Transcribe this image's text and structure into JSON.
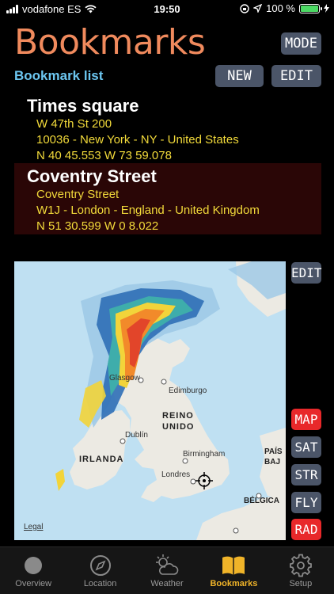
{
  "status_bar": {
    "carrier": "vodafone ES",
    "time": "19:50",
    "battery": "100 %",
    "battery_level": 1.0
  },
  "header": {
    "title": "Bookmarks",
    "mode_label": "MODE"
  },
  "list": {
    "label": "Bookmark list",
    "new_label": "NEW",
    "edit_label": "EDIT"
  },
  "bookmarks": [
    {
      "name": "Times square",
      "street": "W 47th St 200",
      "locality": "10036 - New York - NY - United States",
      "coords": "N 40 45.553   W 73 59.078"
    },
    {
      "name": "Coventry Street",
      "street": "Coventry Street",
      "locality": "W1J - London - England - United Kingdom",
      "coords": "N 51 30.599   W 0 8.022"
    }
  ],
  "map": {
    "edit_label": "EDIT",
    "labels": {
      "glasgow": "Glasgow",
      "edimburgo": "Edimburgo",
      "reino": "REINO",
      "unido": "UNIDO",
      "dublin": "Dublín",
      "irlanda": "IRLANDA",
      "birmingham": "Birmingham",
      "londres": "Londres",
      "pais": "PAÍS",
      "baj": "BAJ",
      "belgica": "BÉLGICA",
      "legal": "Legal"
    },
    "modes": [
      "MAP",
      "SAT",
      "STR",
      "FLY",
      "RAD"
    ],
    "active_modes": [
      "MAP",
      "RAD"
    ]
  },
  "tabs": [
    {
      "label": "Overview",
      "icon": "circle-icon"
    },
    {
      "label": "Location",
      "icon": "compass-icon"
    },
    {
      "label": "Weather",
      "icon": "weather-icon"
    },
    {
      "label": "Bookmarks",
      "icon": "book-icon",
      "active": true
    },
    {
      "label": "Setup",
      "icon": "gear-icon"
    }
  ],
  "colors": {
    "title": "#f08a5d",
    "list_label": "#6cc6f0",
    "detail_text": "#f2da3a",
    "button": "#4b5568",
    "active_mode": "#e8282a",
    "active_tab": "#f0b429"
  }
}
